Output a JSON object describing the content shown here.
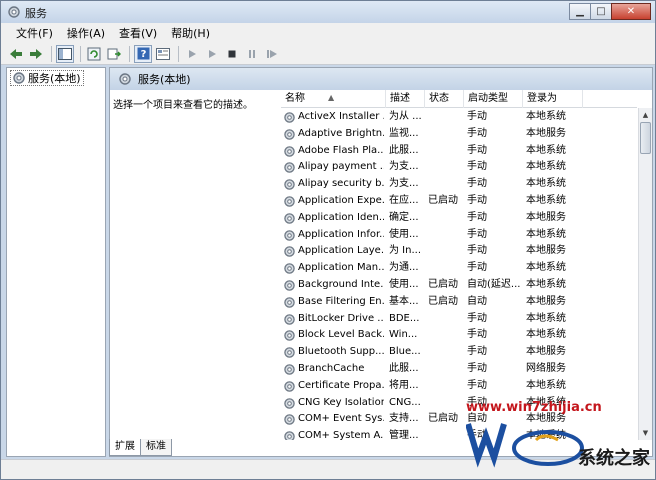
{
  "window": {
    "title": "服务",
    "buttons": {
      "minimize": "▁",
      "maximize": "□",
      "close": "✕"
    }
  },
  "menubar": [
    "文件(F)",
    "操作(A)",
    "查看(V)",
    "帮助(H)"
  ],
  "tree": {
    "root_label": "服务(本地)"
  },
  "content": {
    "header": "服务(本地)",
    "description_hint": "选择一个项目来查看它的描述。"
  },
  "columns": {
    "name": "名称",
    "desc": "描述",
    "status": "状态",
    "startup": "启动类型",
    "logon": "登录为"
  },
  "services": [
    {
      "name": "ActiveX Installer ...",
      "desc": "为从 ...",
      "status": "",
      "startup": "手动",
      "logon": "本地系统"
    },
    {
      "name": "Adaptive Brightn...",
      "desc": "监视...",
      "status": "",
      "startup": "手动",
      "logon": "本地服务"
    },
    {
      "name": "Adobe Flash Pla...",
      "desc": "此服...",
      "status": "",
      "startup": "手动",
      "logon": "本地系统"
    },
    {
      "name": "Alipay payment ...",
      "desc": "为支...",
      "status": "",
      "startup": "手动",
      "logon": "本地系统"
    },
    {
      "name": "Alipay security b...",
      "desc": "为支...",
      "status": "",
      "startup": "手动",
      "logon": "本地系统"
    },
    {
      "name": "Application Expe...",
      "desc": "在应...",
      "status": "已启动",
      "startup": "手动",
      "logon": "本地系统"
    },
    {
      "name": "Application Iden...",
      "desc": "确定...",
      "status": "",
      "startup": "手动",
      "logon": "本地服务"
    },
    {
      "name": "Application Infor...",
      "desc": "使用...",
      "status": "",
      "startup": "手动",
      "logon": "本地系统"
    },
    {
      "name": "Application Laye...",
      "desc": "为 In...",
      "status": "",
      "startup": "手动",
      "logon": "本地服务"
    },
    {
      "name": "Application Man...",
      "desc": "为通...",
      "status": "",
      "startup": "手动",
      "logon": "本地系统"
    },
    {
      "name": "Background Inte...",
      "desc": "使用...",
      "status": "已启动",
      "startup": "自动(延迟...",
      "logon": "本地系统"
    },
    {
      "name": "Base Filtering En...",
      "desc": "基本...",
      "status": "已启动",
      "startup": "自动",
      "logon": "本地服务"
    },
    {
      "name": "BitLocker Drive ...",
      "desc": "BDE...",
      "status": "",
      "startup": "手动",
      "logon": "本地系统"
    },
    {
      "name": "Block Level Back...",
      "desc": "Win...",
      "status": "",
      "startup": "手动",
      "logon": "本地系统"
    },
    {
      "name": "Bluetooth Supp...",
      "desc": "Blue...",
      "status": "",
      "startup": "手动",
      "logon": "本地服务"
    },
    {
      "name": "BranchCache",
      "desc": "此服...",
      "status": "",
      "startup": "手动",
      "logon": "网络服务"
    },
    {
      "name": "Certificate Propa...",
      "desc": "将用...",
      "status": "",
      "startup": "手动",
      "logon": "本地系统"
    },
    {
      "name": "CNG Key Isolation",
      "desc": "CNG...",
      "status": "",
      "startup": "手动",
      "logon": "本地系统"
    },
    {
      "name": "COM+ Event Sys...",
      "desc": "支持...",
      "status": "已启动",
      "startup": "自动",
      "logon": "本地服务"
    },
    {
      "name": "COM+ System A...",
      "desc": "管理...",
      "status": "",
      "startup": "手动",
      "logon": "本地系统"
    }
  ],
  "tabs": [
    "扩展",
    "标准"
  ],
  "watermark": {
    "url": "www.win7zhijia.cn",
    "brand": "系统之家"
  }
}
